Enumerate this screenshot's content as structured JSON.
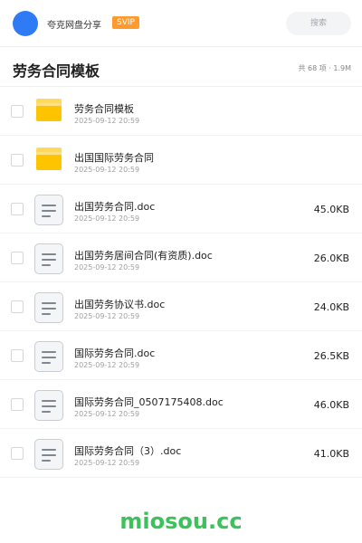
{
  "header": {
    "site_name": "夸克网盘分享",
    "badge": "SVIP",
    "search_placeholder": "搜索"
  },
  "folder": {
    "title": "劳务合同模板",
    "meta": "共 68 项 · 1.9M"
  },
  "items": [
    {
      "type": "folder",
      "name": "劳务合同模板",
      "date": "2025-09-12 20:59",
      "size": ""
    },
    {
      "type": "folder",
      "name": "出国国际劳务合同",
      "date": "2025-09-12 20:59",
      "size": ""
    },
    {
      "type": "doc",
      "name": "出国劳务合同.doc",
      "date": "2025-09-12 20:59",
      "size": "45.0KB"
    },
    {
      "type": "doc",
      "name": "出国劳务居间合同(有资质).doc",
      "date": "2025-09-12 20:59",
      "size": "26.0KB"
    },
    {
      "type": "doc",
      "name": "出国劳务协议书.doc",
      "date": "2025-09-12 20:59",
      "size": "24.0KB"
    },
    {
      "type": "doc",
      "name": "国际劳务合同.doc",
      "date": "2025-09-12 20:59",
      "size": "26.5KB"
    },
    {
      "type": "doc",
      "name": "国际劳务合同_0507175408.doc",
      "date": "2025-09-12 20:59",
      "size": "46.0KB"
    },
    {
      "type": "doc",
      "name": "国际劳务合同（3）.doc",
      "date": "2025-09-12 20:59",
      "size": "41.0KB"
    }
  ],
  "watermark": "miosou.cc",
  "colors": {
    "accent": "#2f7bf5",
    "badge": "#ff9a2e",
    "folder": "#ffc400",
    "watermark": "#3cc25a"
  }
}
